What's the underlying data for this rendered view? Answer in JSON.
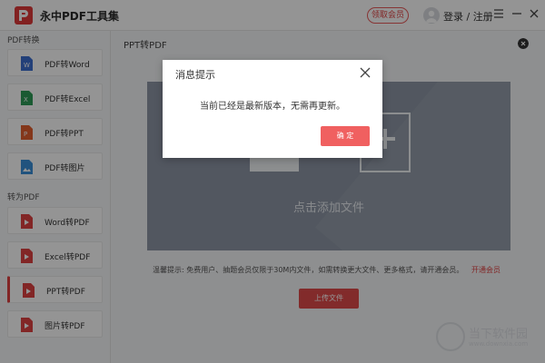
{
  "app": {
    "title": "永中PDF工具集",
    "vip_button": "领取会员",
    "login_text": "登录 / 注册"
  },
  "sidebar": {
    "section_pdf_to": "PDF转换",
    "section_to_pdf": "转为PDF",
    "items": [
      {
        "label": "PDF转Word",
        "icon": "word-doc-icon",
        "color": "#3d6fd1"
      },
      {
        "label": "PDF转Excel",
        "icon": "excel-doc-icon",
        "color": "#2e9b57"
      },
      {
        "label": "PDF转PPT",
        "icon": "ppt-doc-icon",
        "color": "#e3602f"
      },
      {
        "label": "PDF转图片",
        "icon": "image-doc-icon",
        "color": "#3a8fd9"
      },
      {
        "label": "Word转PDF",
        "icon": "pdf-doc-icon",
        "color": "#e04343"
      },
      {
        "label": "Excel转PDF",
        "icon": "pdf-doc-icon",
        "color": "#e04343"
      },
      {
        "label": "PPT转PDF",
        "icon": "pdf-doc-icon",
        "color": "#e04343",
        "active": true
      },
      {
        "label": "图片转PDF",
        "icon": "pdf-doc-icon",
        "color": "#e04343"
      }
    ]
  },
  "main": {
    "title": "PPT转PDF",
    "drop_label": "点击添加文件",
    "tip": "温馨提示: 免费用户、抽题会员仅限于30M内文件，如需转换更大文件、更多格式，请开通会员。",
    "tip_link": "开通会员",
    "upload_button": "上传文件"
  },
  "dialog": {
    "title": "消息提示",
    "message": "当前已经是最新版本，无需再更新。",
    "confirm": "确 定"
  },
  "watermark": {
    "text": "当下软件园",
    "url": "www.downxia.com"
  },
  "colors": {
    "accent": "#e04343",
    "drop_area": "#8d97a5",
    "confirm_button": "#f06060"
  }
}
